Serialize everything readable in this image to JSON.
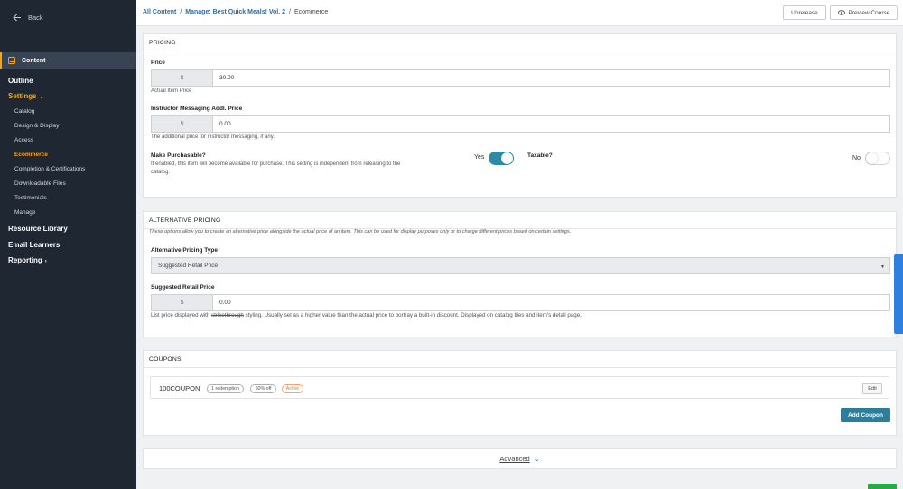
{
  "sidebar": {
    "back_label": "Back",
    "content_label": "Content",
    "items": [
      {
        "label": "Outline",
        "level": "top"
      },
      {
        "label": "Settings",
        "level": "top",
        "expanded": true
      },
      {
        "label": "Catalog",
        "level": "sub"
      },
      {
        "label": "Design & Display",
        "level": "sub"
      },
      {
        "label": "Access",
        "level": "sub"
      },
      {
        "label": "Ecommerce",
        "level": "sub",
        "active": true
      },
      {
        "label": "Completion & Certifications",
        "level": "sub"
      },
      {
        "label": "Downloadable Files",
        "level": "sub"
      },
      {
        "label": "Testimonials",
        "level": "sub"
      },
      {
        "label": "Manage",
        "level": "sub"
      },
      {
        "label": "Resource Library",
        "level": "top"
      },
      {
        "label": "Email Learners",
        "level": "top"
      },
      {
        "label": "Reporting",
        "level": "top"
      }
    ]
  },
  "header": {
    "crumb_all": "All Content",
    "crumb_sep": "/",
    "crumb_manage": "Manage: Best Quick Meals! Vol. 2",
    "crumb_current": "Ecommerce",
    "unrelease_label": "Unrelease",
    "preview_label": "Preview Course"
  },
  "pricing": {
    "title": "PRICING",
    "price_label": "Price",
    "currency": "$",
    "price_value": "30.00",
    "price_help": "Actual Item Price",
    "instructor_label": "Instructor Messaging Addl. Price",
    "instructor_value": "0.00",
    "instructor_help": "The additional price for instructor messaging, if any.",
    "purchasable_label": "Make Purchasable?",
    "purchasable_help": "If enabled, this item will become available for purchase. This setting is independent from releasing to the catalog.",
    "purchasable_state": "Yes",
    "taxable_label": "Taxable?",
    "taxable_state": "No"
  },
  "alt_pricing": {
    "title": "ALTERNATIVE PRICING",
    "description": "These options allow you to create an alternative price alongside the actual price of an item. This can be used for display purposes only or to charge different prices based on certain settings.",
    "type_label": "Alternative Pricing Type",
    "type_value": "Suggested Retail Price",
    "srp_label": "Suggested Retail Price",
    "currency": "$",
    "srp_value": "0.00",
    "help_prefix": "List price displayed with",
    "help_strike": "strikethrough",
    "help_suffix": "styling. Usually set as a higher value than the actual price to portray a built-in discount. Displayed on catalog tiles and item's detail page."
  },
  "coupons": {
    "title": "COUPONS",
    "items": [
      {
        "code": "100COUPON",
        "redemptions": "1 redemption",
        "discount": "50% off",
        "status": "Active",
        "edit_label": "Edit"
      }
    ],
    "add_label": "Add Coupon"
  },
  "advanced": {
    "label": "Advanced"
  },
  "colors": {
    "sidebar_bg": "#1e2732",
    "accent": "#f2a516",
    "toggle_on": "#2f8aa8",
    "primary_button": "#2c7e9a",
    "link": "#2a6fa8"
  }
}
